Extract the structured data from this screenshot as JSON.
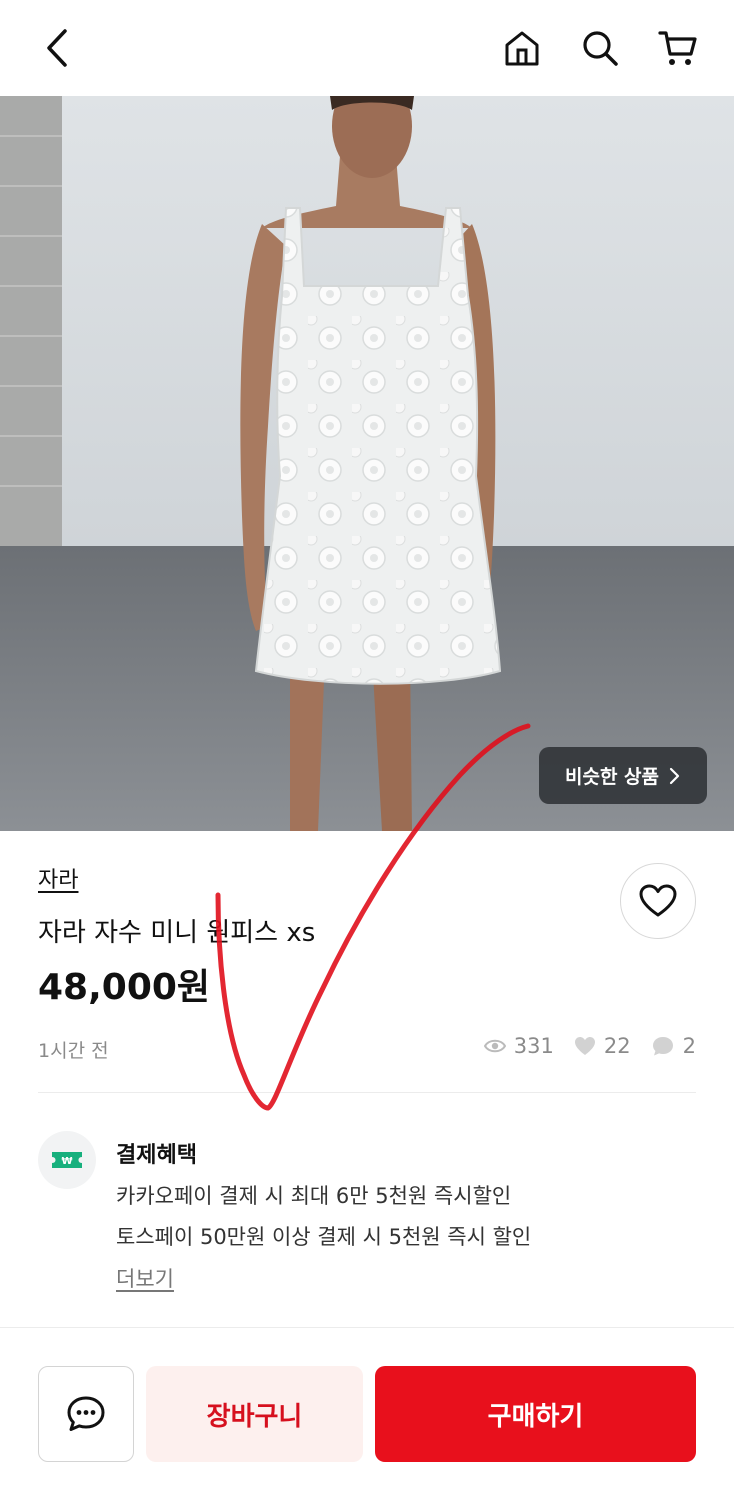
{
  "header": {
    "back_icon": "chevron-left-icon",
    "home_icon": "home-icon",
    "search_icon": "search-icon",
    "cart_icon": "cart-icon"
  },
  "hero": {
    "similar_label": "비슷한 상품"
  },
  "product": {
    "brand": "자라",
    "title": "자라 자수 미니 원피스 xs",
    "price": "48,000원",
    "posted": "1시간 전",
    "views": "331",
    "likes": "22",
    "chats": "2"
  },
  "benefit": {
    "title": "결제혜택",
    "line1": "카카오페이 결제 시 최대 6만 5천원 즉시할인",
    "line2": "토스페이 50만원 이상 결제 시 5천원 즉시 할인",
    "more": "더보기"
  },
  "footer": {
    "cart_label": "장바구니",
    "buy_label": "구매하기"
  },
  "colors": {
    "accent": "#e8101c",
    "cart_bg": "#fdf0ee",
    "cart_text": "#d6101e",
    "annotation": "#e0101c"
  }
}
